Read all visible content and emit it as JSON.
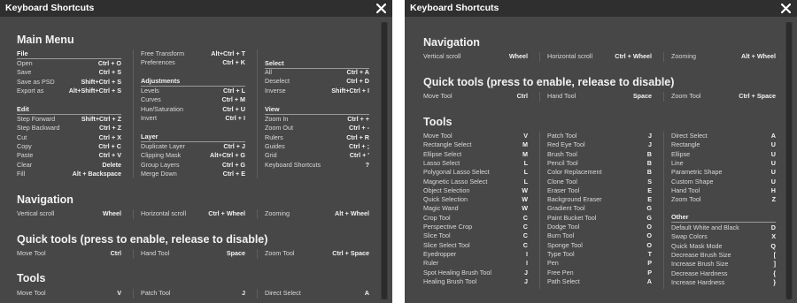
{
  "dialog": {
    "title": "Keyboard Shortcuts"
  },
  "left": {
    "main_menu": {
      "heading": "Main Menu",
      "file": {
        "label": "File",
        "items": [
          {
            "name": "Open",
            "key": "Ctrl + O"
          },
          {
            "name": "Save",
            "key": "Ctrl + S"
          },
          {
            "name": "Save as PSD",
            "key": "Shift+Ctrl + S"
          },
          {
            "name": "Export as",
            "key": "Alt+Shift+Ctrl + S"
          }
        ]
      },
      "edit": {
        "label": "Edit",
        "items": [
          {
            "name": "Step Forward",
            "key": "Shift+Ctrl + Z"
          },
          {
            "name": "Step Backward",
            "key": "Ctrl + Z"
          },
          {
            "name": "Cut",
            "key": "Ctrl + X"
          },
          {
            "name": "Copy",
            "key": "Ctrl + C"
          },
          {
            "name": "Paste",
            "key": "Ctrl + V"
          },
          {
            "name": "Clear",
            "key": "Delete"
          },
          {
            "name": "Fill",
            "key": "Alt + Backspace"
          }
        ]
      },
      "misc": [
        {
          "name": "Free Transform",
          "key": "Alt+Ctrl + T"
        },
        {
          "name": "Preferences",
          "key": "Ctrl + K"
        }
      ],
      "adjustments": {
        "label": "Adjustments",
        "items": [
          {
            "name": "Levels",
            "key": "Ctrl + L"
          },
          {
            "name": "Curves",
            "key": "Ctrl + M"
          },
          {
            "name": "Hue/Saturation",
            "key": "Ctrl + U"
          },
          {
            "name": "Invert",
            "key": "Ctrl + I"
          }
        ]
      },
      "layer": {
        "label": "Layer",
        "items": [
          {
            "name": "Duplicate Layer",
            "key": "Ctrl + J"
          },
          {
            "name": "Clipping Mask",
            "key": "Alt+Ctrl + G"
          },
          {
            "name": "Group Layers",
            "key": "Ctrl + G"
          },
          {
            "name": "Merge Down",
            "key": "Ctrl + E"
          }
        ]
      },
      "select": {
        "label": "Select",
        "items": [
          {
            "name": "All",
            "key": "Ctrl + A"
          },
          {
            "name": "Deselect",
            "key": "Ctrl + D"
          },
          {
            "name": "Inverse",
            "key": "Shift+Ctrl + I"
          }
        ]
      },
      "view": {
        "label": "View",
        "items": [
          {
            "name": "Zoom In",
            "key": "Ctrl + +"
          },
          {
            "name": "Zoom Out",
            "key": "Ctrl + -"
          },
          {
            "name": "Rulers",
            "key": "Ctrl + R"
          },
          {
            "name": "Guides",
            "key": "Ctrl + ;"
          },
          {
            "name": "Grid",
            "key": "Ctrl + '"
          },
          {
            "name": "Keyboard Shortcuts",
            "key": "?"
          }
        ]
      }
    },
    "navigation": {
      "heading": "Navigation",
      "items": [
        {
          "name": "Vertical scroll",
          "key": "Wheel"
        },
        {
          "name": "Horizontal scroll",
          "key": "Ctrl + Wheel"
        },
        {
          "name": "Zooming",
          "key": "Alt + Wheel"
        }
      ]
    },
    "quick": {
      "heading": "Quick tools (press to enable, release to disable)",
      "items": [
        {
          "name": "Move Tool",
          "key": "Ctrl"
        },
        {
          "name": "Hand Tool",
          "key": "Space"
        },
        {
          "name": "Zoom Tool",
          "key": "Ctrl + Space"
        }
      ]
    },
    "tools": {
      "heading": "Tools",
      "items": [
        {
          "name": "Move Tool",
          "key": "V"
        },
        {
          "name": "Patch Tool",
          "key": "J"
        },
        {
          "name": "Direct Select",
          "key": "A"
        }
      ]
    }
  },
  "right": {
    "navigation": {
      "heading": "Navigation",
      "items": [
        {
          "name": "Vertical scroll",
          "key": "Wheel"
        },
        {
          "name": "Horizontal scroll",
          "key": "Ctrl + Wheel"
        },
        {
          "name": "Zooming",
          "key": "Alt + Wheel"
        }
      ]
    },
    "quick": {
      "heading": "Quick tools (press to enable, release to disable)",
      "items": [
        {
          "name": "Move Tool",
          "key": "Ctrl"
        },
        {
          "name": "Hand Tool",
          "key": "Space"
        },
        {
          "name": "Zoom Tool",
          "key": "Ctrl + Space"
        }
      ]
    },
    "tools": {
      "heading": "Tools",
      "col1": [
        {
          "name": "Move Tool",
          "key": "V"
        },
        {
          "name": "Rectangle Select",
          "key": "M"
        },
        {
          "name": "Ellipse Select",
          "key": "M"
        },
        {
          "name": "Lasso Select",
          "key": "L"
        },
        {
          "name": "Polygonal Lasso Select",
          "key": "L"
        },
        {
          "name": "Magnetic Lasso Select",
          "key": "L"
        },
        {
          "name": "Object Selection",
          "key": "W"
        },
        {
          "name": "Quick Selection",
          "key": "W"
        },
        {
          "name": "Magic Wand",
          "key": "W"
        },
        {
          "name": "Crop Tool",
          "key": "C"
        },
        {
          "name": "Perspective Crop",
          "key": "C"
        },
        {
          "name": "Slice Tool",
          "key": "C"
        },
        {
          "name": "Slice Select Tool",
          "key": "C"
        },
        {
          "name": "Eyedropper",
          "key": "I"
        },
        {
          "name": "Ruler",
          "key": "I"
        },
        {
          "name": "Spot Healing Brush Tool",
          "key": "J"
        },
        {
          "name": "Healing Brush Tool",
          "key": "J"
        }
      ],
      "col2": [
        {
          "name": "Patch Tool",
          "key": "J"
        },
        {
          "name": "Red Eye Tool",
          "key": "J"
        },
        {
          "name": "Brush Tool",
          "key": "B"
        },
        {
          "name": "Pencil Tool",
          "key": "B"
        },
        {
          "name": "Color Replacement",
          "key": "B"
        },
        {
          "name": "Clone Tool",
          "key": "S"
        },
        {
          "name": "Eraser Tool",
          "key": "E"
        },
        {
          "name": "Background Eraser",
          "key": "E"
        },
        {
          "name": "Gradient Tool",
          "key": "G"
        },
        {
          "name": "Paint Bucket Tool",
          "key": "G"
        },
        {
          "name": "Dodge Tool",
          "key": "O"
        },
        {
          "name": "Burn Tool",
          "key": "O"
        },
        {
          "name": "Sponge Tool",
          "key": "O"
        },
        {
          "name": "Type Tool",
          "key": "T"
        },
        {
          "name": "Pen",
          "key": "P"
        },
        {
          "name": "Free Pen",
          "key": "P"
        },
        {
          "name": "Path Select",
          "key": "A"
        }
      ],
      "col3": [
        {
          "name": "Direct Select",
          "key": "A"
        },
        {
          "name": "Rectangle",
          "key": "U"
        },
        {
          "name": "Ellipse",
          "key": "U"
        },
        {
          "name": "Line",
          "key": "U"
        },
        {
          "name": "Parametric Shape",
          "key": "U"
        },
        {
          "name": "Custom Shape",
          "key": "U"
        },
        {
          "name": "Hand Tool",
          "key": "H"
        },
        {
          "name": "Zoom Tool",
          "key": "Z"
        }
      ]
    },
    "other": {
      "label": "Other",
      "items": [
        {
          "name": "Default White and Black",
          "key": "D"
        },
        {
          "name": "Swap Colors",
          "key": "X"
        },
        {
          "name": "Quick Mask Mode",
          "key": "Q"
        },
        {
          "name": "Decrease Brush Size",
          "key": "["
        },
        {
          "name": "Increase Brush Size",
          "key": "]"
        },
        {
          "name": "Decrease Hardness",
          "key": "{"
        },
        {
          "name": "Increase Hardness",
          "key": "}"
        }
      ]
    }
  },
  "colors": {
    "panel": "#474747",
    "titlebar": "#2f2f2f",
    "text": "#e6e6e6",
    "divider": "#9a9a9a"
  }
}
